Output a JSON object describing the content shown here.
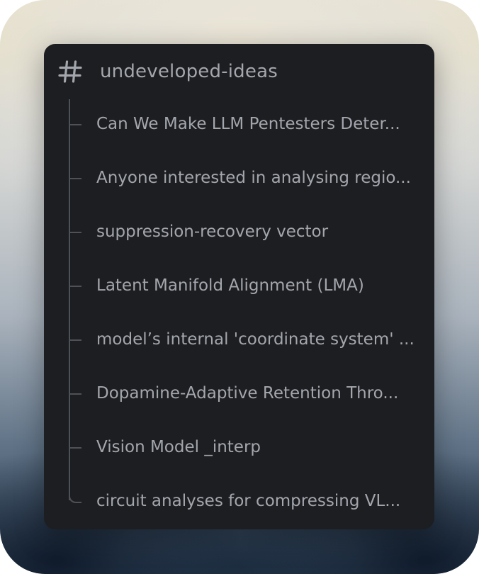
{
  "channel": {
    "name": "undeveloped-ideas",
    "icon": "hash-icon"
  },
  "threads": [
    {
      "label": "Can We Make LLM Pentesters Deter..."
    },
    {
      "label": "Anyone interested in analysing regio..."
    },
    {
      "label": "suppression-recovery vector"
    },
    {
      "label": "Latent Manifold Alignment (LMA)"
    },
    {
      "label": "model’s internal 'coordinate system' ..."
    },
    {
      "label": "Dopamine-Adaptive Retention Thro..."
    },
    {
      "label": "Vision Model _interp"
    },
    {
      "label": "circuit analyses for compressing VL..."
    }
  ],
  "colors": {
    "panel_bg": "#1d1e21",
    "text": "#a3a6ad",
    "thread_line": "#4f5158"
  }
}
